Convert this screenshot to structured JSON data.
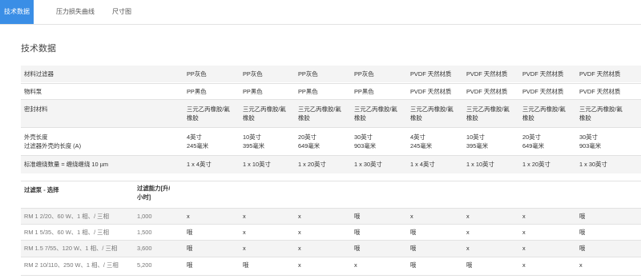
{
  "tabs": [
    {
      "label": "技术数据",
      "active": true
    },
    {
      "label": "压力损失曲线",
      "active": false
    },
    {
      "label": "尺寸图",
      "active": false
    }
  ],
  "page_title": "技术数据",
  "colors": {
    "accent": "#3a8ee6",
    "stripe": "#f4f4f4"
  },
  "spec_table": {
    "rows": [
      {
        "label": "材料过滤器",
        "values": [
          "PP灰色",
          "PP灰色",
          "PP灰色",
          "PP灰色",
          "PVDF 天然材质",
          "PVDF 天然材质",
          "PVDF 天然材质",
          "PVDF 天然材质"
        ]
      },
      {
        "label": "物料泵",
        "values": [
          "PP黑色",
          "PP黑色",
          "PP黑色",
          "PP黑色",
          "PVDF 天然材质",
          "PVDF 天然材质",
          "PVDF 天然材质",
          "PVDF 天然材质"
        ]
      },
      {
        "label": "密封材料",
        "values": [
          "三元乙丙橡胶/氟\n橡胶",
          "三元乙丙橡胶/氟\n橡胶",
          "三元乙丙橡胶/氟\n橡胶",
          "三元乙丙橡胶/氟\n橡胶",
          "三元乙丙橡胶/氟\n橡胶",
          "三元乙丙橡胶/氟\n橡胶",
          "三元乙丙橡胶/氟\n橡胶",
          "三元乙丙橡胶/氟\n橡胶"
        ]
      },
      {
        "label": "外壳长度\n过滤器外壳的长度 (A)",
        "values": [
          "4英寸\n245毫米",
          "10英寸\n395毫米",
          "20英寸\n649毫米",
          "30英寸\n903毫米",
          "4英寸\n245毫米",
          "10英寸\n395毫米",
          "20英寸\n649毫米",
          "30英寸\n903毫米"
        ]
      },
      {
        "label": "标准缠绕数量 = 缠绕缠绕 10 µm",
        "values": [
          "1 x 4英寸",
          "1 x 10英寸",
          "1 x 20英寸",
          "1 x 30英寸",
          "1 x 4英寸",
          "1 x 10英寸",
          "1 x 20英寸",
          "1 x 30英寸"
        ]
      }
    ]
  },
  "pump_table": {
    "header": {
      "pump": "过滤泵 - 选择",
      "capacity": "过滤能力[升/\n小时]"
    },
    "rows": [
      {
        "pump": "RM 1 2/20、60 W、1 相、/ 三相",
        "capacity": "1,000",
        "marks": [
          "x",
          "x",
          "x",
          "哦",
          "x",
          "x",
          "x",
          "哦"
        ]
      },
      {
        "pump": "RM 1 5/35、60 W、1 相、/ 三相",
        "capacity": "1,500",
        "marks": [
          "哦",
          "x",
          "x",
          "哦",
          "哦",
          "x",
          "x",
          "哦"
        ]
      },
      {
        "pump": "RM 1.5 7/55、120 W、1 相、/ 三相",
        "capacity": "3,600",
        "marks": [
          "哦",
          "x",
          "x",
          "哦",
          "哦",
          "x",
          "x",
          "哦"
        ]
      },
      {
        "pump": "RM 2 10/110、250 W、1 相、/ 三相",
        "capacity": "5,200",
        "marks": [
          "哦",
          "哦",
          "x",
          "x",
          "哦",
          "哦",
          "x",
          "x"
        ]
      }
    ]
  }
}
